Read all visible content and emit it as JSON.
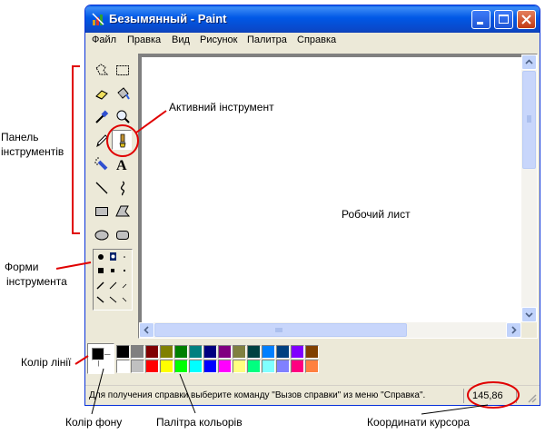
{
  "window": {
    "title": "Безымянный - Paint",
    "minimize_label": "minimize",
    "maximize_label": "maximize",
    "close_label": "close"
  },
  "menu": [
    {
      "label": "Файл"
    },
    {
      "label": "Правка"
    },
    {
      "label": "Вид"
    },
    {
      "label": "Рисунок"
    },
    {
      "label": "Палитра"
    },
    {
      "label": "Справка"
    }
  ],
  "tools": [
    {
      "name": "free-form-select-icon"
    },
    {
      "name": "rect-select-icon"
    },
    {
      "name": "eraser-icon"
    },
    {
      "name": "fill-bucket-icon"
    },
    {
      "name": "color-picker-icon"
    },
    {
      "name": "magnifier-icon"
    },
    {
      "name": "pencil-icon"
    },
    {
      "name": "brush-icon",
      "selected": true
    },
    {
      "name": "airbrush-icon"
    },
    {
      "name": "text-icon",
      "glyph": "A"
    },
    {
      "name": "line-icon"
    },
    {
      "name": "curve-icon"
    },
    {
      "name": "rectangle-icon"
    },
    {
      "name": "polygon-icon"
    },
    {
      "name": "ellipse-icon"
    },
    {
      "name": "rounded-rect-icon"
    }
  ],
  "colors": {
    "foreground": "#000000",
    "background": "#ffffff",
    "palette_row1": [
      "#000000",
      "#808080",
      "#800000",
      "#808000",
      "#008000",
      "#008080",
      "#000080",
      "#800080",
      "#808040",
      "#004040",
      "#0080ff",
      "#004080",
      "#8000ff",
      "#804000"
    ],
    "palette_row2": [
      "#ffffff",
      "#c0c0c0",
      "#ff0000",
      "#ffff00",
      "#00ff00",
      "#00ffff",
      "#0000ff",
      "#ff00ff",
      "#ffff80",
      "#00ff80",
      "#80ffff",
      "#8080ff",
      "#ff0080",
      "#ff8040"
    ],
    "annotation_red": "#e00000"
  },
  "status": {
    "help_text": "Для получения справки выберите команду \"Вызов справки\" из меню \"Справка\".",
    "coords": "145,86"
  },
  "annotations": {
    "active_tool": "Активний інструмент",
    "toolbar_line1": "Панель",
    "toolbar_line2": "інструментів",
    "worksheet": "Робочий лист",
    "shapes_line1": "Форми",
    "shapes_line2": "інструмента",
    "line_color": "Колір лінії",
    "bg_color": "Колір фону",
    "palette": "Палітра кольорів",
    "cursor_coords": "Координати курсора"
  }
}
